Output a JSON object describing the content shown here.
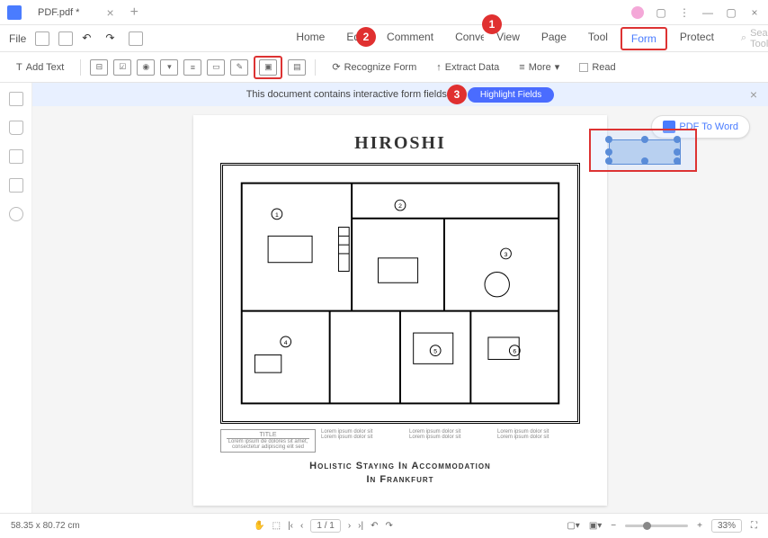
{
  "titlebar": {
    "filename": "PDF.pdf *"
  },
  "menubar": {
    "file": "File",
    "tabs": [
      "Home",
      "Edit",
      "Comment",
      "Convert",
      "View",
      "Page",
      "Tool",
      "Form",
      "Protect"
    ],
    "search_placeholder": "Search Tools"
  },
  "toolbar": {
    "add_text": "Add Text",
    "recognize_form": "Recognize Form",
    "extract_data": "Extract Data",
    "more": "More",
    "read": "Read"
  },
  "banner": {
    "message": "This document contains interactive form fields.",
    "button": "Highlight Fields"
  },
  "sidebar_button": "PDF To Word",
  "document": {
    "title": "HIROSHI",
    "subtitle_line1": "Holistic Staying In Accommodation",
    "subtitle_line2": "In Frankfurt",
    "title_label": "TITLE",
    "lorem_snippet": "Lorem ipsum dolor sit",
    "lorem_long": "Lorem ipsum de dolores sit amet, consectetur adipiscing elit sed"
  },
  "callouts": {
    "c1": "1",
    "c2": "2",
    "c3": "3"
  },
  "status": {
    "coords": "58.35 x 80.72 cm",
    "page": "1",
    "total": "1",
    "zoom": "33%"
  }
}
